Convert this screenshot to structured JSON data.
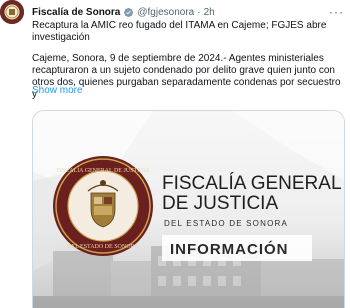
{
  "author": {
    "display_name": "Fiscalía de Sonora",
    "handle": "@fgjesonora",
    "separator": "·",
    "time": "2h"
  },
  "tweet": {
    "headline": "Recaptura la AMIC reo fugado del ITAMA en Cajeme; FGJES abre investigación",
    "body": "Cajeme, Sonora, 9 de septiembre de 2024.- Agentes ministeriales recapturaron a un sujeto condenado por delito grave quien junto con otros dos, quienes purgaban separadamente condenas por secuestro y",
    "show_more": "Show more"
  },
  "media": {
    "line1": "FISCALÍA GENERAL",
    "line2": "DE JUSTICIA",
    "line3": "DEL ESTADO DE SONORA",
    "badge": "INFORMACIÓN",
    "seal_top": "FISCALÍA GENERAL DE JUSTICIA",
    "seal_bottom": "DEL ESTADO DE SONORA"
  },
  "icons": {
    "avatar": "avatar-image",
    "verified": "verified-badge-icon",
    "more": "more-options-icon"
  },
  "colors": {
    "brand_maroon": "#6b1f1f",
    "gold": "#c9a24a",
    "link": "#1d9bf0",
    "muted": "#536471"
  }
}
